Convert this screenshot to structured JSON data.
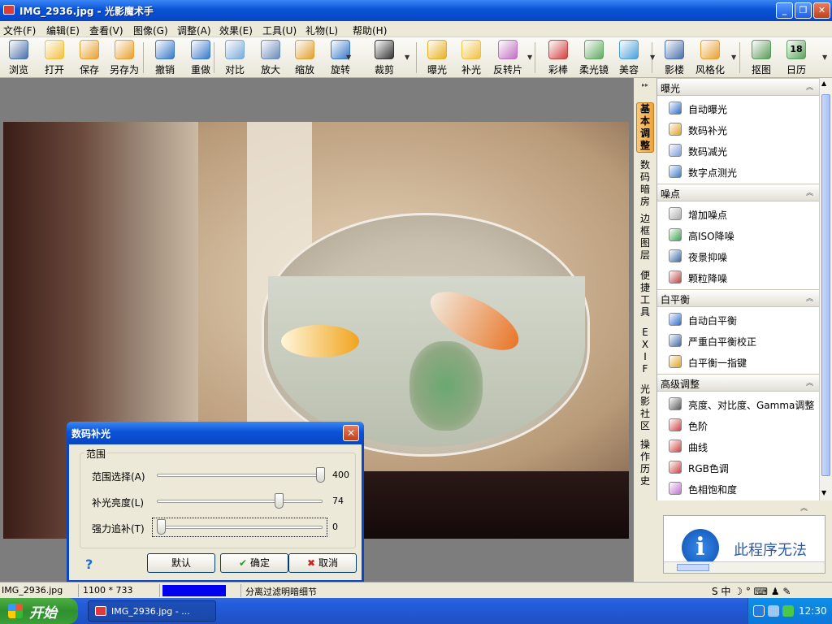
{
  "window": {
    "title": "IMG_2936.jpg - 光影魔术手",
    "controls": [
      "_",
      "❐",
      "✕"
    ]
  },
  "menu": [
    "文件(F)",
    "编辑(E)",
    "查看(V)",
    "图像(G)",
    "调整(A)",
    "效果(E)",
    "工具(U)",
    "礼物(L)",
    "帮助(H)"
  ],
  "toolbar": [
    {
      "label": "浏览",
      "icon": "browse-icon",
      "color": "#4a6fa8"
    },
    {
      "label": "打开",
      "icon": "folder-icon",
      "color": "#f0c040"
    },
    {
      "label": "保存",
      "icon": "save-icon",
      "color": "#e8a030"
    },
    {
      "label": "另存为",
      "icon": "save-as-icon",
      "color": "#e8a030"
    },
    {
      "label": "撤销",
      "icon": "undo-icon",
      "color": "#3a78c8"
    },
    {
      "label": "重做",
      "icon": "redo-icon",
      "color": "#3a78c8"
    },
    {
      "label": "对比",
      "icon": "compare-icon",
      "color": "#7aaad8"
    },
    {
      "label": "放大",
      "icon": "zoom-icon",
      "color": "#6a8ab8"
    },
    {
      "label": "缩放",
      "icon": "resize-icon",
      "color": "#e0a030"
    },
    {
      "label": "旋转",
      "icon": "rotate-icon",
      "color": "#3a78c8"
    },
    {
      "label": "裁剪",
      "icon": "crop-icon",
      "color": "#333333"
    },
    {
      "label": "曝光",
      "icon": "exposure-icon",
      "color": "#e8b020"
    },
    {
      "label": "补光",
      "icon": "fill-light-icon",
      "color": "#f0c040"
    },
    {
      "label": "反转片",
      "icon": "reversal-film-icon",
      "color": "#c070c0"
    },
    {
      "label": "彩棒",
      "icon": "color-wand-icon",
      "color": "#d04040"
    },
    {
      "label": "柔光镜",
      "icon": "soft-light-icon",
      "color": "#60a860"
    },
    {
      "label": "美容",
      "icon": "beauty-icon",
      "color": "#4aa0d8"
    },
    {
      "label": "影楼",
      "icon": "studio-icon",
      "color": "#4a6fa8"
    },
    {
      "label": "风格化",
      "icon": "stylize-icon",
      "color": "#e8a030"
    },
    {
      "label": "抠图",
      "icon": "cutout-icon",
      "color": "#5a9a5a"
    },
    {
      "label": "日历",
      "icon": "calendar-icon",
      "color": "#5aa05a",
      "badge": "18"
    }
  ],
  "side_tabs": [
    "基本调整",
    "数码暗房",
    "边框图层",
    "便捷工具",
    "EXIF",
    "光影社区",
    "操作历史"
  ],
  "panel": {
    "exposure": {
      "title": "曝光",
      "items": [
        "自动曝光",
        "数码补光",
        "数码减光",
        "数字点测光"
      ]
    },
    "noise": {
      "title": "噪点",
      "items": [
        "增加噪点",
        "高ISO降噪",
        "夜景抑噪",
        "颗粒降噪"
      ]
    },
    "wb": {
      "title": "白平衡",
      "items": [
        "自动白平衡",
        "严重白平衡校正",
        "白平衡一指键"
      ]
    },
    "advanced": {
      "title": "高级调整",
      "items": [
        "亮度、对比度、Gamma调整",
        "色阶",
        "曲线",
        "RGB色调",
        "色相饱和度"
      ]
    }
  },
  "infobox": {
    "text": "此程序无法"
  },
  "dialog": {
    "title": "数码补光",
    "group": "范围",
    "sliders": [
      {
        "label": "范围选择(A)",
        "value": "400",
        "fraction": 1.0
      },
      {
        "label": "补光亮度(L)",
        "value": "74",
        "fraction": 0.74
      },
      {
        "label": "强力追补(T)",
        "value": "0",
        "fraction": 0.0
      }
    ],
    "help": "?",
    "buttons": {
      "default": "默认",
      "ok": "确定",
      "cancel": "取消"
    }
  },
  "status": {
    "filename": "IMG_2936.jpg",
    "size": "1100 * 733",
    "hint": "分离过滤明暗细节",
    "progress_color": "#0000ee"
  },
  "ime": "S 中 ☽ ° ⌨ ♟ ✎",
  "taskbar": {
    "start": "开始",
    "item": "IMG_2936.jpg - ...",
    "clock": "12:30"
  }
}
